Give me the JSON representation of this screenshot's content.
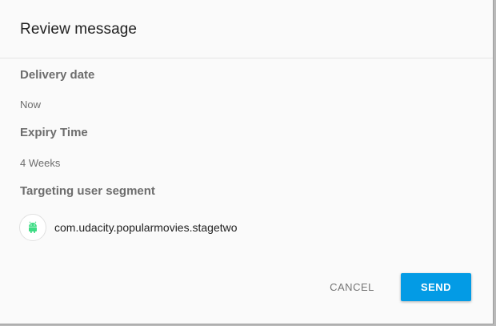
{
  "dialog": {
    "title": "Review message"
  },
  "delivery": {
    "label": "Delivery date",
    "value": "Now"
  },
  "expiry": {
    "label": "Expiry Time",
    "value": "4 Weeks"
  },
  "targeting": {
    "label": "Targeting user segment",
    "segment_icon": "android-icon",
    "segment_name": "com.udacity.popularmovies.stagetwo"
  },
  "actions": {
    "cancel_label": "CANCEL",
    "send_label": "SEND"
  },
  "colors": {
    "accent": "#039be5",
    "android_green": "#3ddc84"
  }
}
